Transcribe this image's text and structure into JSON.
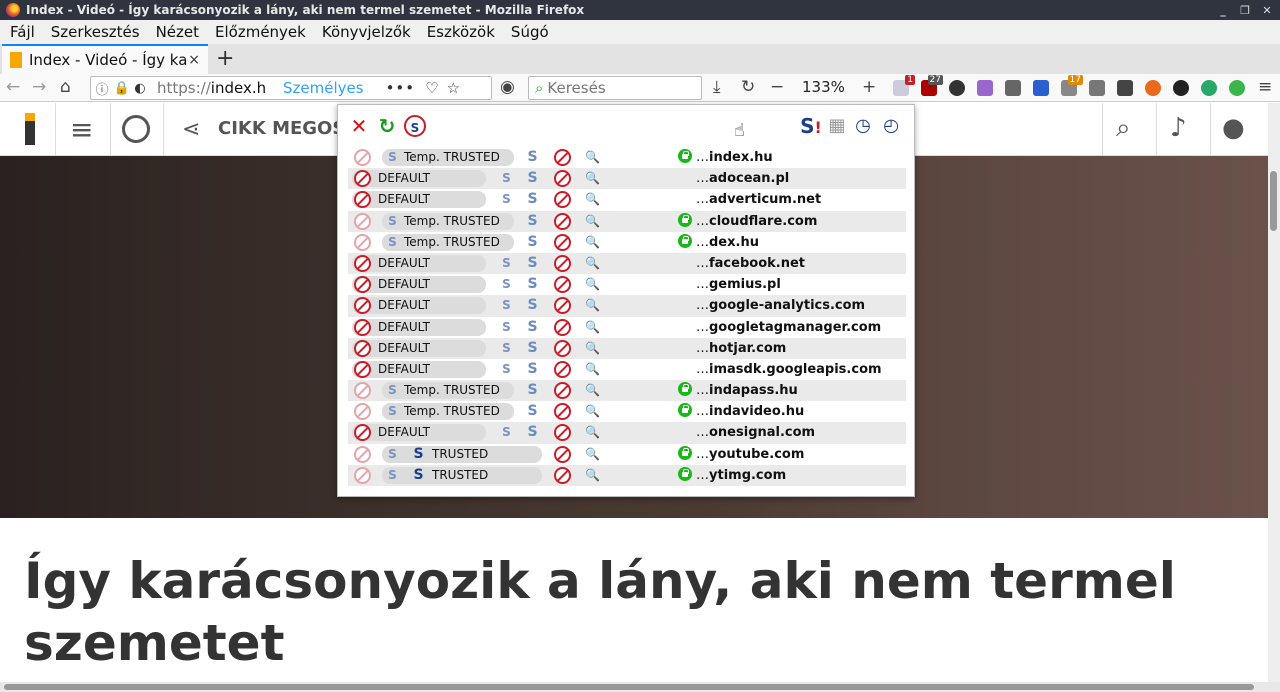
{
  "window": {
    "title": "Index - Videó - Így karácsonyozik a lány, aki nem termel szemetet - Mozilla Firefox"
  },
  "menu": [
    "Fájl",
    "Szerkesztés",
    "Nézet",
    "Előzmények",
    "Könyvjelzők",
    "Eszközök",
    "Súgó"
  ],
  "tab": {
    "title": "Index - Videó - Így ka",
    "close": "×"
  },
  "toolbar": {
    "url_prefix": "https://",
    "url_host": "index.hu",
    "container_label": "Személyes",
    "more_dots": "•••",
    "search_placeholder": "Keresés",
    "zoom": "133%",
    "zoom_minus": "−",
    "zoom_plus": "+",
    "badge_noscript": "1",
    "badge_ublock": "27",
    "badge_orange": "17"
  },
  "site": {
    "share_label": "CIKK MEGOSZ",
    "headline": "Így karácsonyozik a lány, aki nem termel szemetet"
  },
  "colors": {
    "noscript_red": "#c81e2a",
    "trusted_lock_green": "#18b818",
    "container_blue": "#2ea3f2",
    "title_bar": "#2f343f"
  },
  "popup": {
    "rows": [
      {
        "level": "Temp. TRUSTED",
        "domain": "index.hu",
        "locked": true
      },
      {
        "level": "DEFAULT",
        "domain": "adocean.pl",
        "locked": false
      },
      {
        "level": "DEFAULT",
        "domain": "adverticum.net",
        "locked": false
      },
      {
        "level": "Temp. TRUSTED",
        "domain": "cloudflare.com",
        "locked": true
      },
      {
        "level": "Temp. TRUSTED",
        "domain": "dex.hu",
        "locked": true
      },
      {
        "level": "DEFAULT",
        "domain": "facebook.net",
        "locked": false
      },
      {
        "level": "DEFAULT",
        "domain": "gemius.pl",
        "locked": false
      },
      {
        "level": "DEFAULT",
        "domain": "google-analytics.com",
        "locked": false
      },
      {
        "level": "DEFAULT",
        "domain": "googletagmanager.com",
        "locked": false
      },
      {
        "level": "DEFAULT",
        "domain": "hotjar.com",
        "locked": false
      },
      {
        "level": "DEFAULT",
        "domain": "imasdk.googleapis.com",
        "locked": false
      },
      {
        "level": "Temp. TRUSTED",
        "domain": "indapass.hu",
        "locked": true
      },
      {
        "level": "Temp. TRUSTED",
        "domain": "indavideo.hu",
        "locked": true
      },
      {
        "level": "DEFAULT",
        "domain": "onesignal.com",
        "locked": false
      },
      {
        "level": "TRUSTED",
        "domain": "youtube.com",
        "locked": true
      },
      {
        "level": "TRUSTED",
        "domain": "ytimg.com",
        "locked": true
      }
    ],
    "domain_prefix": "…"
  }
}
